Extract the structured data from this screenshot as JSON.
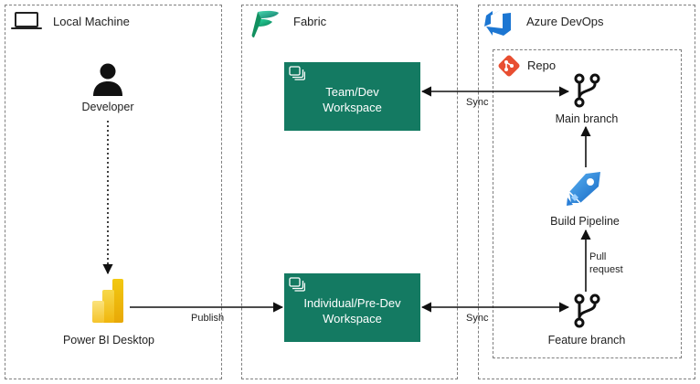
{
  "panels": {
    "local": {
      "title": "Local Machine"
    },
    "fabric": {
      "title": "Fabric"
    },
    "azure": {
      "title": "Azure DevOps"
    },
    "repo": {
      "title": "Repo"
    }
  },
  "nodes": {
    "developer": "Developer",
    "powerbi": "Power BI Desktop",
    "team_ws_line1": "Team/Dev",
    "team_ws_line2": "Workspace",
    "indiv_ws_line1": "Individual/Pre-Dev",
    "indiv_ws_line2": "Workspace",
    "main_branch": "Main branch",
    "build_pipeline": "Build Pipeline",
    "feature_branch": "Feature branch"
  },
  "edges": {
    "publish": "Publish",
    "sync_top": "Sync",
    "sync_bottom": "Sync",
    "pull_request_line1": "Pull",
    "pull_request_line2": "request"
  },
  "colors": {
    "workspace": "#147a62",
    "azure_blue": "#1c76d2",
    "git_orange": "#e84e31",
    "powerbi_yellow": "#f2c811"
  },
  "icons": {
    "laptop": "laptop-icon",
    "fabric": "fabric-logo-icon",
    "azure_devops": "azure-devops-icon",
    "git": "git-icon",
    "person": "person-icon",
    "powerbi": "power-bi-icon",
    "branch": "branch-icon",
    "pipeline": "azure-pipelines-icon",
    "workspace": "workspace-icon"
  }
}
